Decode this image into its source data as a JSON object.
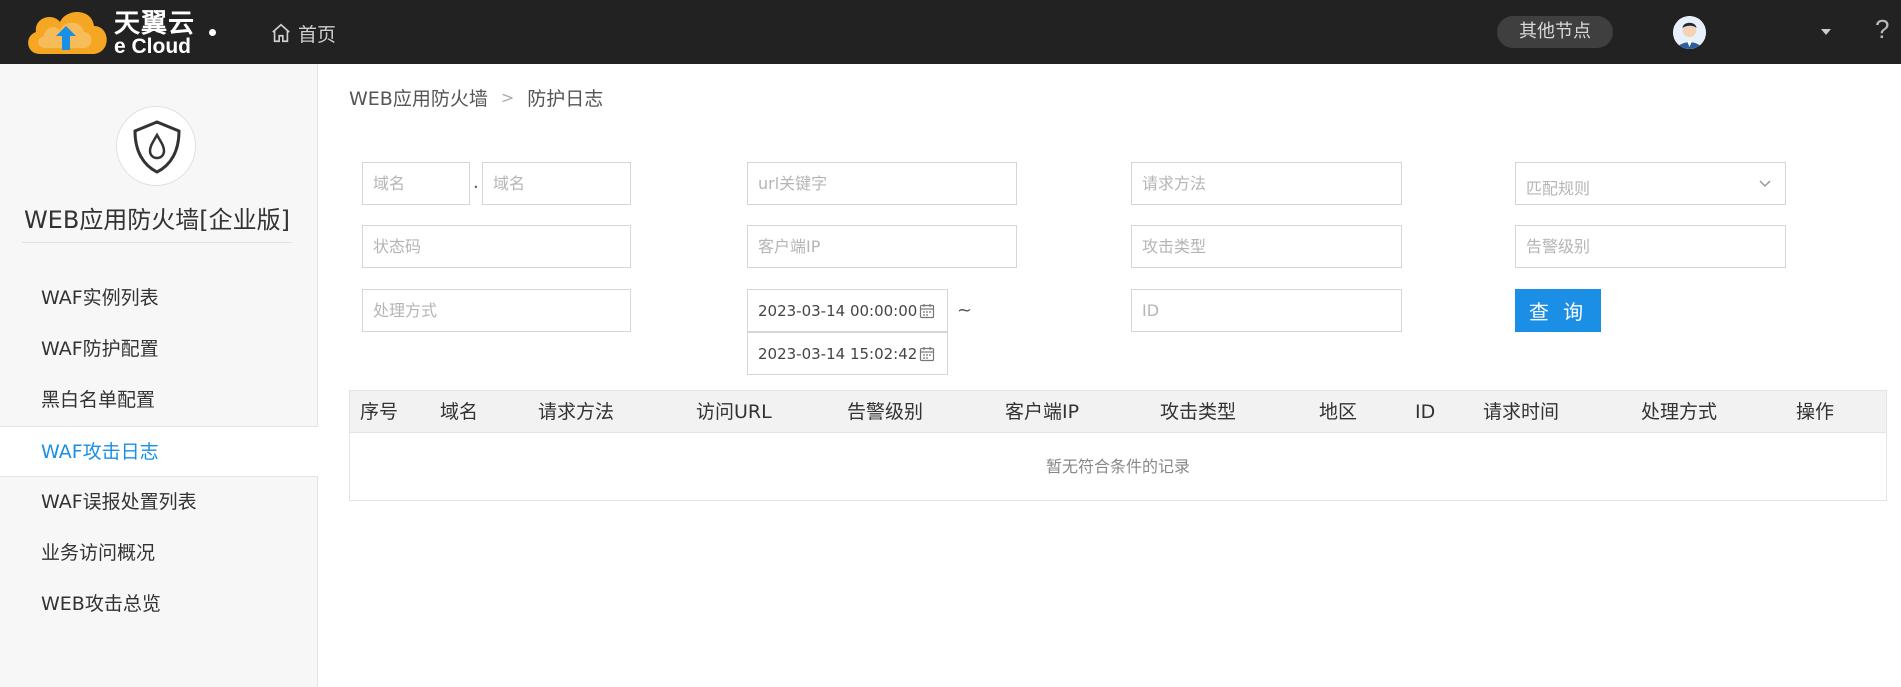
{
  "topbar": {
    "logo_cn": "天翼云",
    "logo_en": "e Cloud",
    "home_label": "首页",
    "other_nodes_label": "其他节点",
    "help_label": "?"
  },
  "sidebar": {
    "title": "WEB应用防火墙[企业版]",
    "items": [
      {
        "label": "WAF实例列表"
      },
      {
        "label": "WAF防护配置"
      },
      {
        "label": "黑白名单配置"
      },
      {
        "label": "WAF攻击日志"
      },
      {
        "label": "WAF误报处置列表"
      },
      {
        "label": "业务访问概况"
      },
      {
        "label": "WEB攻击总览"
      }
    ],
    "active_index": 3
  },
  "breadcrumb": {
    "parent": "WEB应用防火墙",
    "separator": ">",
    "current": "防护日志"
  },
  "filters": {
    "domain_prefix_placeholder": "域名",
    "domain_separator": ".",
    "domain_suffix_placeholder": "域名",
    "url_keyword_placeholder": "url关键字",
    "request_method_placeholder": "请求方法",
    "match_rule_placeholder": "匹配规则",
    "status_code_placeholder": "状态码",
    "client_ip_placeholder": "客户端IP",
    "attack_type_placeholder": "攻击类型",
    "alert_level_placeholder": "告警级别",
    "handling_placeholder": "处理方式",
    "start_time": "2023-03-14 00:00:00",
    "range_separator": "~",
    "end_time": "2023-03-14 15:02:42",
    "id_placeholder": "ID",
    "query_label": "查 询"
  },
  "table": {
    "columns": [
      "序号",
      "域名",
      "请求方法",
      "访问URL",
      "告警级别",
      "客户端IP",
      "攻击类型",
      "地区",
      "ID",
      "请求时间",
      "处理方式",
      "操作"
    ],
    "empty_text": "暂无符合条件的记录"
  },
  "colors": {
    "topbar_bg": "#222222",
    "accent": "#1b8fe6",
    "logo_orange": "#f5a623"
  },
  "icons": {
    "home": "home-icon",
    "calendar": "calendar-icon",
    "chevron": "chevron-down-icon",
    "shield": "shield-drop-icon"
  }
}
